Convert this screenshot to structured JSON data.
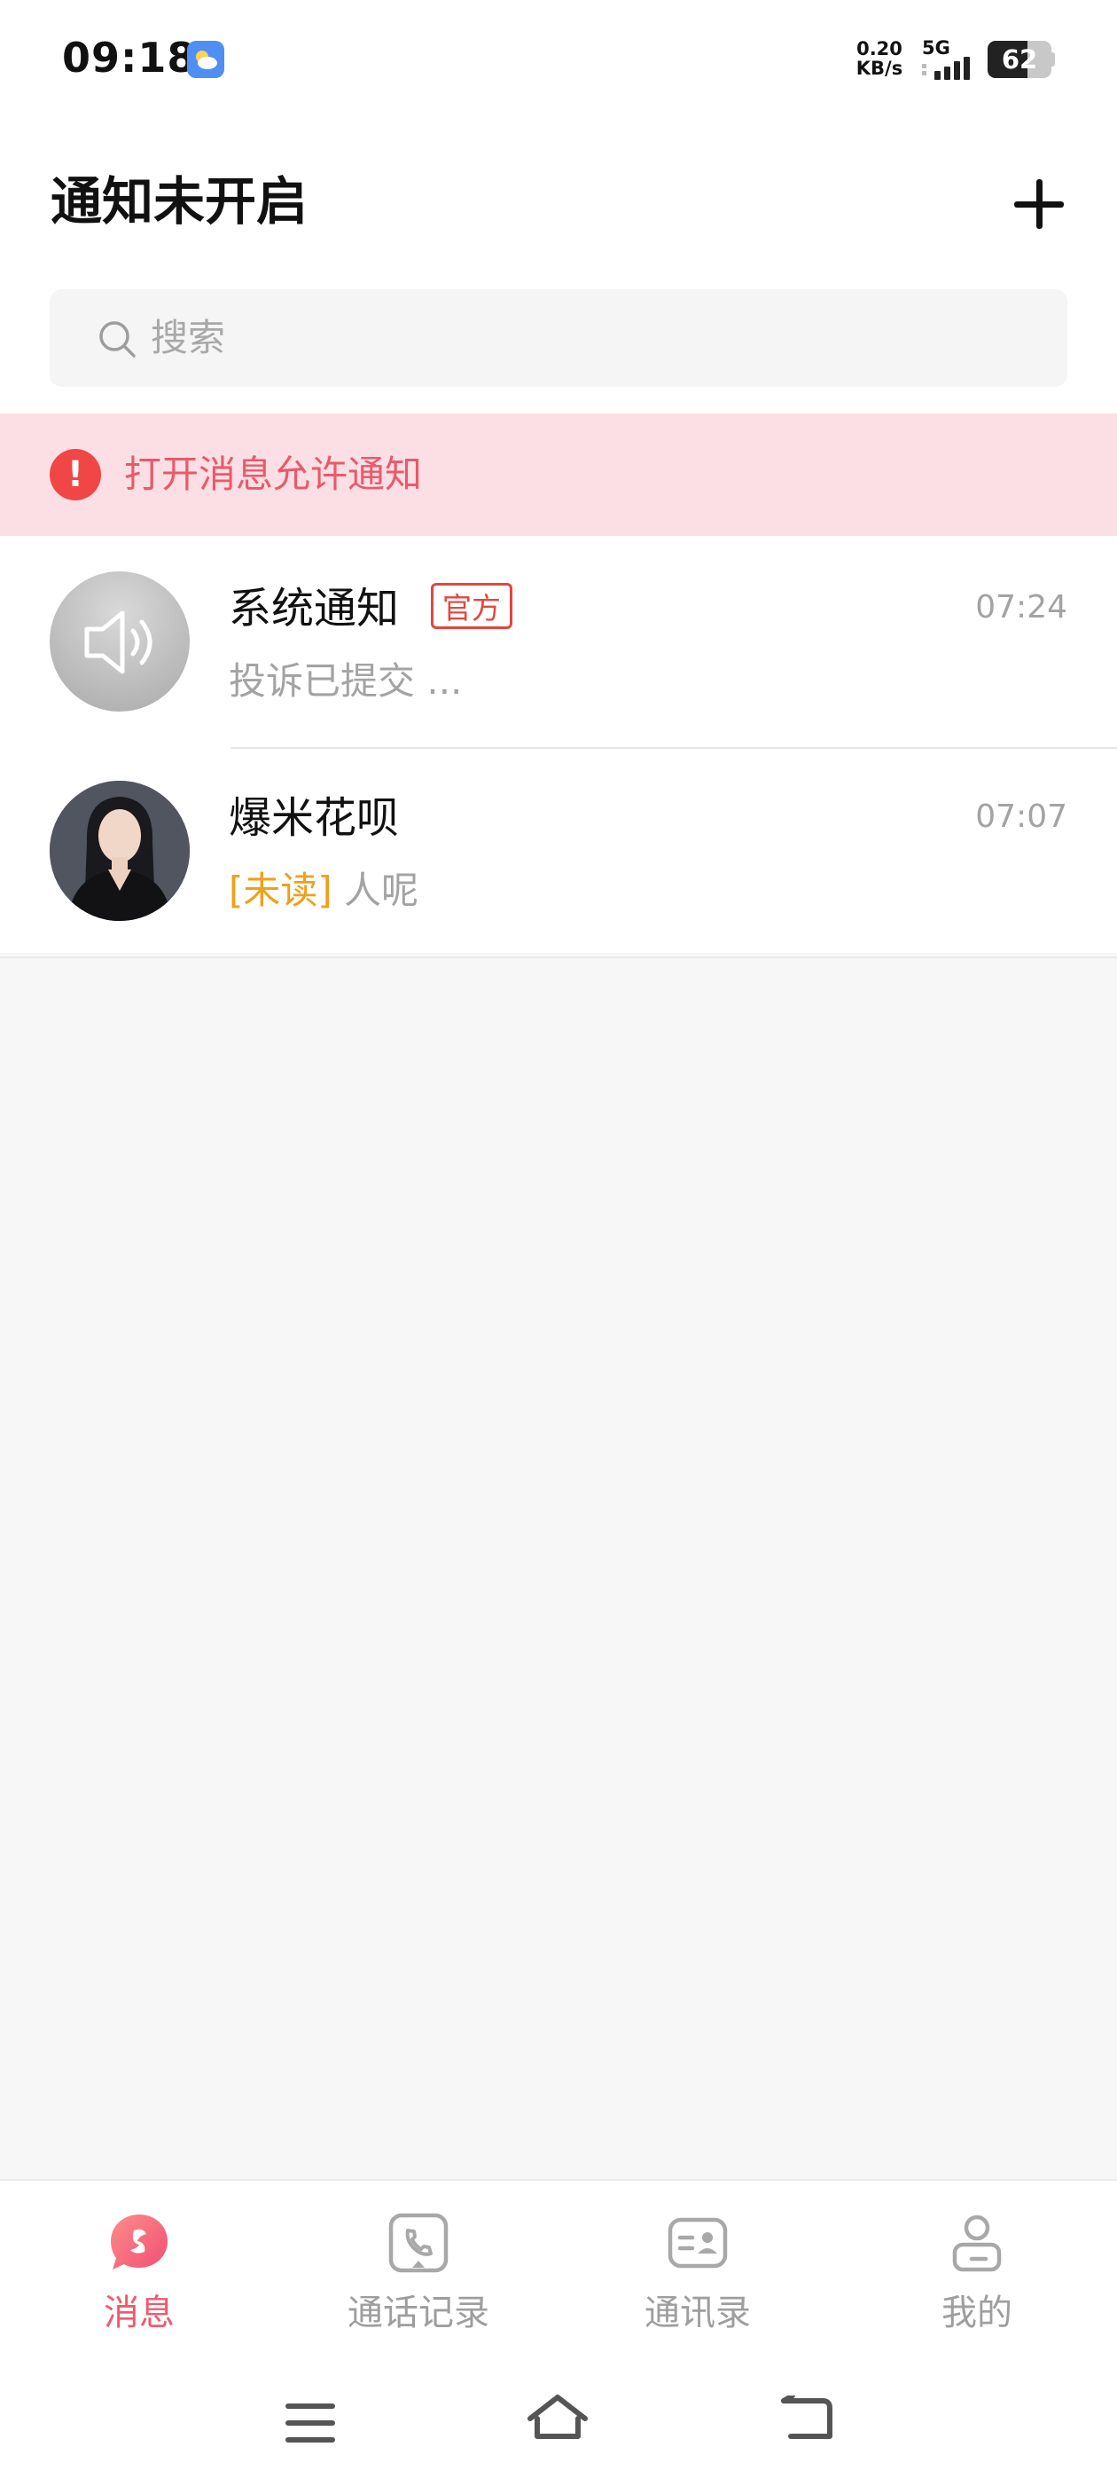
{
  "status_bar": {
    "time": "09:18",
    "net_speed_value": "0.20",
    "net_speed_unit": "KB/s",
    "network": "5G",
    "battery": "62",
    "battery_level_percent": 62
  },
  "header": {
    "title": "通知未开启",
    "add_icon": "plus-icon"
  },
  "search": {
    "placeholder": "搜索",
    "icon": "search-icon"
  },
  "notification_banner": {
    "text": "打开消息允许通知",
    "icon": "exclamation-icon",
    "background_color": "#fcdfe4",
    "text_color": "#e85a6c"
  },
  "conversations": [
    {
      "name": "系统通知",
      "badge": "官方",
      "time": "07:24",
      "message": "投诉已提交 ...",
      "avatar": "speaker-icon"
    },
    {
      "name": "爆米花呗",
      "time": "07:07",
      "unread_tag": "[未读]",
      "message": "人呢",
      "avatar": "person-photo"
    }
  ],
  "tabs": [
    {
      "label": "消息",
      "icon": "message-icon",
      "active": true
    },
    {
      "label": "通话记录",
      "icon": "phone-icon",
      "active": false
    },
    {
      "label": "通讯录",
      "icon": "contact-card-icon",
      "active": false
    },
    {
      "label": "我的",
      "icon": "profile-icon",
      "active": false
    }
  ],
  "colors": {
    "accent": "#ef5a6f",
    "official_badge": "#e2473f",
    "unread": "#f0a019"
  }
}
